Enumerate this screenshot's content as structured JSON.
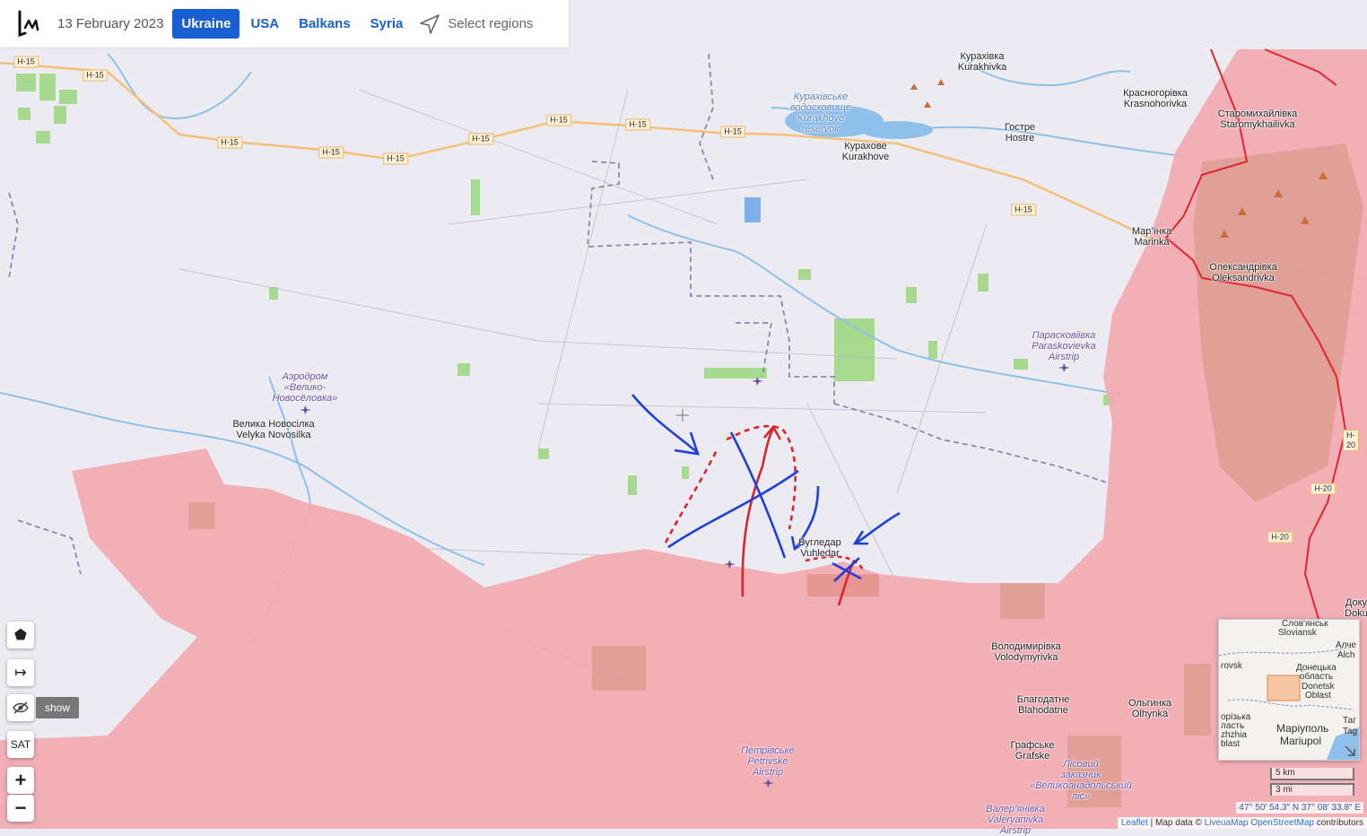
{
  "topbar": {
    "date": "13 February 2023",
    "tabs": [
      {
        "label": "Ukraine",
        "active": true
      },
      {
        "label": "USA",
        "active": false
      },
      {
        "label": "Balkans",
        "active": false
      },
      {
        "label": "Syria",
        "active": false
      }
    ],
    "select_regions": "Select regions"
  },
  "map": {
    "places": {
      "kurakhivka": [
        "Курахівка",
        "Kurakhivka"
      ],
      "reservoir": [
        "Курахівське",
        "водосховище",
        "Kurakhove",
        "reservoir"
      ],
      "kurakhove": [
        "Курахове",
        "Kurakhove"
      ],
      "krasnohorivka": [
        "Красногорівка",
        "Krasnohorivka"
      ],
      "hostre": [
        "Гостре",
        "Hostre"
      ],
      "staromykhailivka": [
        "Старомихайлівка",
        "Staromykhailivka"
      ],
      "marinka": [
        "Мар’їнка",
        "Marinka"
      ],
      "oleksandrivka": [
        "Олександрівка",
        "Oleksandrivka"
      ],
      "paraskovievka": [
        "Парасковіївка",
        "Paraskovievka",
        "Airstrip"
      ],
      "aerodrom": [
        "Аэродром",
        "«Велико-",
        "Новосёловка»"
      ],
      "velyka_novosilka": [
        "Велика Новосілка",
        "Velyka Novosilka"
      ],
      "vuhledar": [
        "Вугледар",
        "Vuhledar"
      ],
      "volodymyrivka": [
        "Володимирівка",
        "Volodymyrivka"
      ],
      "blahodatne": [
        "Благодатне",
        "Blahodatne"
      ],
      "olhynka": [
        "Ольгинка",
        "Olhynka"
      ],
      "grafske": [
        "Графське",
        "Grafske"
      ],
      "petrivske": [
        "Петрівське",
        "Petrivske",
        "Airstrip"
      ],
      "lisovyi": [
        "Лісовий",
        "заказник",
        "«Великоанадольський",
        "ліс»"
      ],
      "valeryanivka": [
        "Валер’янівка",
        "Valeryanivka",
        "Airstrip"
      ],
      "doku": [
        "Доку",
        "Doku"
      ]
    },
    "roads": [
      "H-15",
      "H-15",
      "H-15",
      "H-15",
      "H-15",
      "H-15",
      "H-15",
      "H-15",
      "H-15",
      "H-15",
      "H-20",
      "H-20",
      "H-20"
    ],
    "colors": {
      "occupied": "#f2a9b1",
      "frontline": "#e0262f",
      "ukr_arrows": "#1e3fd8",
      "rus_arrows": "#d9272e",
      "background": "#ecebf1",
      "fields": "#8fd46e",
      "water": "#8ec0ea",
      "roads": "#f5c07a"
    }
  },
  "controls": {
    "polygon_icon": "⬟",
    "measure_icon": "↦",
    "hide_icon": "hide-eye",
    "show_label": "show",
    "sat_label": "SAT",
    "zoom_in": "+",
    "zoom_out": "−"
  },
  "minimap": {
    "labels": [
      "Слов'янськ",
      "Sloviansk",
      "Алче",
      "Alch",
      "rovsk",
      "Донецька",
      "область",
      "Donetsk",
      "Oblast",
      "орізька",
      "ласть",
      "zhzhia",
      "blast",
      "Маріуполь",
      "Mariupol",
      "Таг",
      "Tag"
    ]
  },
  "scale": {
    "km": "5 km",
    "mi": "3 mi"
  },
  "coords": "47° 50′ 54.3″ N 37° 08′ 33.8″ E",
  "attribution": {
    "leaflet": "Leaflet",
    "sep": " | Map data © ",
    "liveua": "LiveuaMap",
    "osm": "OpenStreetMap",
    "contributors": " contributors"
  }
}
